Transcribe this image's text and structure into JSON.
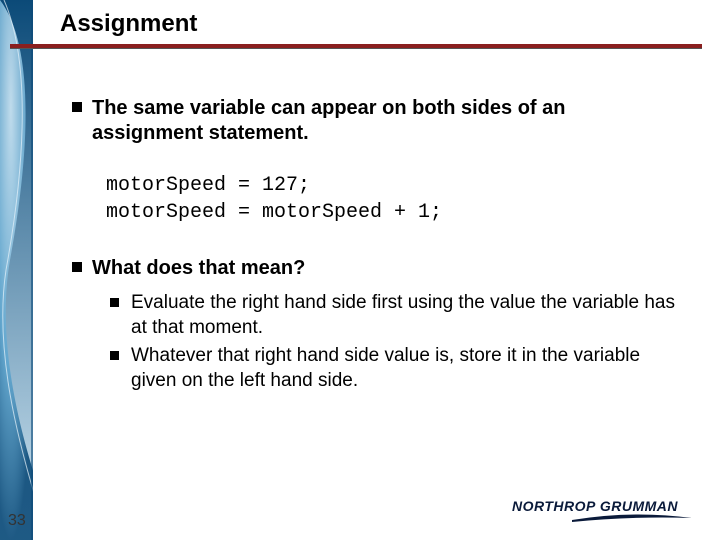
{
  "title": "Assignment",
  "bullets": {
    "b1": "The same variable can appear on both sides of an assignment statement.",
    "code_line1": "motorSpeed = 127;",
    "code_line2": "motorSpeed = motorSpeed + 1;",
    "b2_head": "What does that mean?",
    "b2_sub1": "Evaluate the right hand side first using the value the variable has at that moment.",
    "b2_sub2": "Whatever that right hand side value is, store it in the variable given on the left hand side."
  },
  "page_number": "33",
  "logo": {
    "word1": "NORTHROP",
    "word2": "GRUMMAN"
  },
  "colors": {
    "rule": "#8a1f1f",
    "sidebar_dark": "#0b4a78",
    "sidebar_light": "#6fb2d8",
    "logo_navy": "#0a1a3a"
  }
}
